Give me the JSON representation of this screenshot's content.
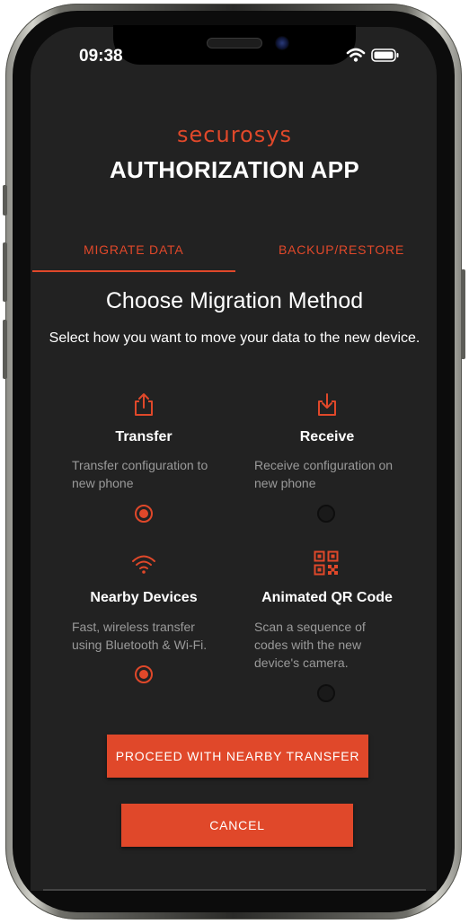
{
  "status_bar": {
    "time": "09:38"
  },
  "brand": {
    "logo_text": "securosys",
    "app_title": "AUTHORIZATION APP"
  },
  "tabs": [
    {
      "label": "MIGRATE DATA",
      "active": true
    },
    {
      "label": "BACKUP/RESTORE",
      "active": false
    }
  ],
  "section": {
    "title": "Choose Migration Method",
    "subtitle": "Select how you want to move your data to the new device."
  },
  "direction_options": [
    {
      "icon": "share-upload-icon",
      "title": "Transfer",
      "desc_lines": [
        "Transfer configuration to",
        "new phone"
      ],
      "selected": true
    },
    {
      "icon": "download-icon",
      "title": "Receive",
      "desc_lines": [
        "Receive configuration on",
        "new phone"
      ],
      "selected": false
    }
  ],
  "method_options": [
    {
      "icon": "wifi-icon",
      "title": "Nearby Devices",
      "desc_lines": [
        "Fast, wireless transfer",
        "using Bluetooth & Wi-Fi."
      ],
      "selected": true
    },
    {
      "icon": "qr-code-icon",
      "title": "Animated QR Code",
      "desc_lines": [
        "Scan a sequence of",
        "codes with the new",
        "device's camera."
      ],
      "selected": false
    }
  ],
  "buttons": {
    "proceed": "PROCEED WITH NEARBY TRANSFER",
    "cancel": "CANCEL"
  },
  "colors": {
    "accent": "#e0482a",
    "background": "#222222",
    "text": "#ffffff",
    "muted_text": "#9a9a9a"
  }
}
